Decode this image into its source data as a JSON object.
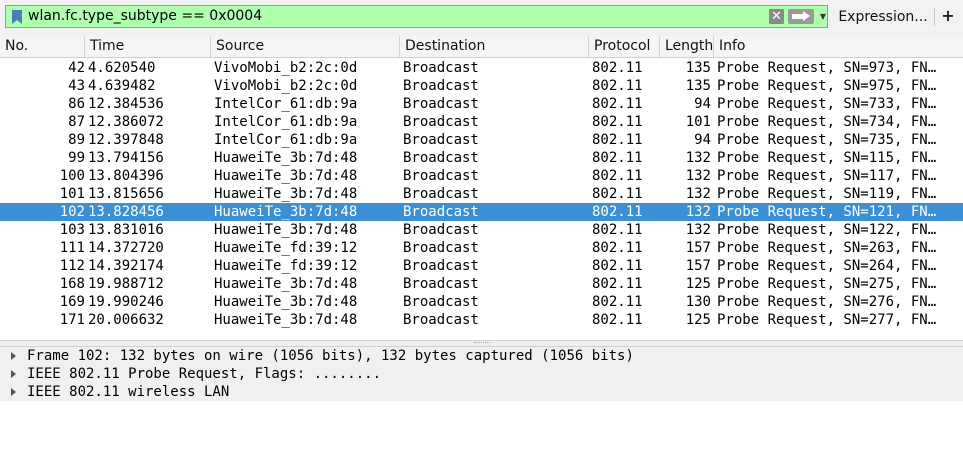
{
  "filter": {
    "value": "wlan.fc.type_subtype == 0x0004",
    "clear_glyph": "✕",
    "dropdown_glyph": "▼",
    "expression_label": "Expression...",
    "add_label": "+"
  },
  "icons": {
    "bookmark": "bookmark-icon",
    "clear": "clear-icon",
    "apply": "arrow-right-icon",
    "dropdown": "chevron-down-icon",
    "expand": "triangle-right-icon"
  },
  "colors": {
    "filter_valid_bg": "#afffaf",
    "selected_row_bg": "#3b8fd4",
    "selected_row_fg": "#ffffff"
  },
  "columns": {
    "no": "No.",
    "time": "Time",
    "source": "Source",
    "destination": "Destination",
    "protocol": "Protocol",
    "length": "Length",
    "info": "Info"
  },
  "packets": [
    {
      "no": "42",
      "time": "4.620540",
      "source": "VivoMobi_b2:2c:0d",
      "destination": "Broadcast",
      "protocol": "802.11",
      "length": "135",
      "info": "Probe Request, SN=973, FN…"
    },
    {
      "no": "43",
      "time": "4.639482",
      "source": "VivoMobi_b2:2c:0d",
      "destination": "Broadcast",
      "protocol": "802.11",
      "length": "135",
      "info": "Probe Request, SN=975, FN…"
    },
    {
      "no": "86",
      "time": "12.384536",
      "source": "IntelCor_61:db:9a",
      "destination": "Broadcast",
      "protocol": "802.11",
      "length": "94",
      "info": "Probe Request, SN=733, FN…"
    },
    {
      "no": "87",
      "time": "12.386072",
      "source": "IntelCor_61:db:9a",
      "destination": "Broadcast",
      "protocol": "802.11",
      "length": "101",
      "info": "Probe Request, SN=734, FN…"
    },
    {
      "no": "89",
      "time": "12.397848",
      "source": "IntelCor_61:db:9a",
      "destination": "Broadcast",
      "protocol": "802.11",
      "length": "94",
      "info": "Probe Request, SN=735, FN…"
    },
    {
      "no": "99",
      "time": "13.794156",
      "source": "HuaweiTe_3b:7d:48",
      "destination": "Broadcast",
      "protocol": "802.11",
      "length": "132",
      "info": "Probe Request, SN=115, FN…"
    },
    {
      "no": "100",
      "time": "13.804396",
      "source": "HuaweiTe_3b:7d:48",
      "destination": "Broadcast",
      "protocol": "802.11",
      "length": "132",
      "info": "Probe Request, SN=117, FN…"
    },
    {
      "no": "101",
      "time": "13.815656",
      "source": "HuaweiTe_3b:7d:48",
      "destination": "Broadcast",
      "protocol": "802.11",
      "length": "132",
      "info": "Probe Request, SN=119, FN…"
    },
    {
      "no": "102",
      "time": "13.828456",
      "source": "HuaweiTe_3b:7d:48",
      "destination": "Broadcast",
      "protocol": "802.11",
      "length": "132",
      "info": "Probe Request, SN=121, FN…",
      "selected": true
    },
    {
      "no": "103",
      "time": "13.831016",
      "source": "HuaweiTe_3b:7d:48",
      "destination": "Broadcast",
      "protocol": "802.11",
      "length": "132",
      "info": "Probe Request, SN=122, FN…"
    },
    {
      "no": "111",
      "time": "14.372720",
      "source": "HuaweiTe_fd:39:12",
      "destination": "Broadcast",
      "protocol": "802.11",
      "length": "157",
      "info": "Probe Request, SN=263, FN…"
    },
    {
      "no": "112",
      "time": "14.392174",
      "source": "HuaweiTe_fd:39:12",
      "destination": "Broadcast",
      "protocol": "802.11",
      "length": "157",
      "info": "Probe Request, SN=264, FN…"
    },
    {
      "no": "168",
      "time": "19.988712",
      "source": "HuaweiTe_3b:7d:48",
      "destination": "Broadcast",
      "protocol": "802.11",
      "length": "125",
      "info": "Probe Request, SN=275, FN…"
    },
    {
      "no": "169",
      "time": "19.990246",
      "source": "HuaweiTe_3b:7d:48",
      "destination": "Broadcast",
      "protocol": "802.11",
      "length": "130",
      "info": "Probe Request, SN=276, FN…"
    },
    {
      "no": "171",
      "time": "20.006632",
      "source": "HuaweiTe_3b:7d:48",
      "destination": "Broadcast",
      "protocol": "802.11",
      "length": "125",
      "info": "Probe Request, SN=277, FN…"
    }
  ],
  "details": [
    "Frame 102: 132 bytes on wire (1056 bits), 132 bytes captured (1056 bits)",
    "IEEE 802.11 Probe Request, Flags: ........",
    "IEEE 802.11 wireless LAN"
  ]
}
